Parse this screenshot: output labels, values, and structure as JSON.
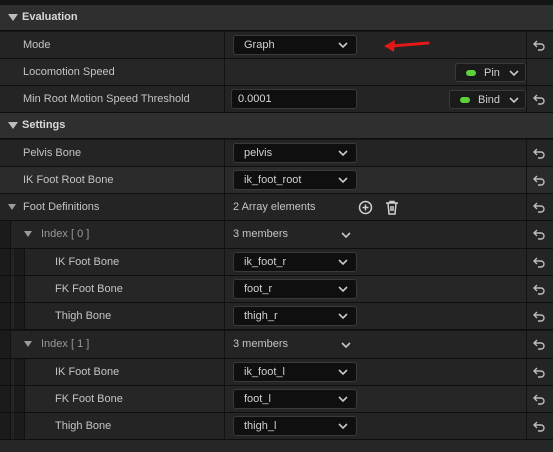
{
  "evaluation": {
    "title": "Evaluation",
    "mode": {
      "label": "Mode",
      "value": "Graph"
    },
    "locomotion_speed": {
      "label": "Locomotion Speed",
      "pin_label": "Pin"
    },
    "min_root_motion": {
      "label": "Min Root Motion Speed Threshold",
      "value": "0.0001",
      "bind_label": "Bind"
    }
  },
  "settings": {
    "title": "Settings",
    "pelvis_bone": {
      "label": "Pelvis Bone",
      "value": "pelvis"
    },
    "ik_foot_root_bone": {
      "label": "IK Foot Root Bone",
      "value": "ik_foot_root"
    },
    "foot_definitions": {
      "label": "Foot Definitions",
      "count_text": "2 Array elements",
      "items": [
        {
          "index_label": "Index [ 0 ]",
          "members_text": "3 members",
          "ik_foot_bone": {
            "label": "IK Foot Bone",
            "value": "ik_foot_r"
          },
          "fk_foot_bone": {
            "label": "FK Foot Bone",
            "value": "foot_r"
          },
          "thigh_bone": {
            "label": "Thigh Bone",
            "value": "thigh_r"
          }
        },
        {
          "index_label": "Index [ 1 ]",
          "members_text": "3 members",
          "ik_foot_bone": {
            "label": "IK Foot Bone",
            "value": "ik_foot_l"
          },
          "fk_foot_bone": {
            "label": "FK Foot Bone",
            "value": "foot_l"
          },
          "thigh_bone": {
            "label": "Thigh Bone",
            "value": "thigh_l"
          }
        }
      ]
    }
  },
  "colors": {
    "accent_pin": "#5bd23a",
    "annotation_arrow": "#e01818"
  },
  "icons": [
    "collapse-triangle-icon",
    "chevron-down-icon",
    "reset-arrow-icon",
    "add-circle-icon",
    "trash-icon",
    "red-arrow-annotation"
  ]
}
